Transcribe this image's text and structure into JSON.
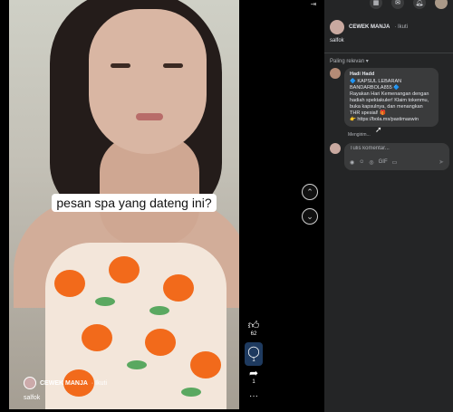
{
  "video": {
    "caption": "pesan spa yang dateng ini?",
    "author_name": "CEWEK MANJA",
    "follow_label": "· Ikuti",
    "description": "salfok"
  },
  "actions": {
    "like_count": "62",
    "comment_count": "1",
    "share_count": "1",
    "more_label": "···"
  },
  "panel": {
    "author_name": "CEWEK MANJA",
    "follow_label": "· Ikuti",
    "post_text": "salfok",
    "sort_label": "Paling relevan ▾",
    "comment": {
      "author": "Hadi Hadd",
      "lines": [
        "🔷 KAPSUL LEBARAN",
        "BANDARBOLA855 🔷",
        "Rayakan Hari Kemenangan dengan",
        "hadiah spektakuler! Klaim tokenmu,",
        "buka kapsulnya, dan menangkan",
        "THR spesial! 🎁",
        "👉 https://bola.ms/pastimaswin"
      ],
      "status": "Mengirim..."
    },
    "compose_placeholder": "Tulis komentar...",
    "compose_tools": [
      "◉",
      "☺",
      "◎",
      "GIF",
      "▭"
    ],
    "send_icon": "send-icon"
  },
  "colors": {
    "panel_bg": "#242526",
    "bubble_bg": "#3a3b3c",
    "text": "#e4e6eb",
    "muted": "#b0b3b8",
    "accent": "#4ea2ff"
  }
}
